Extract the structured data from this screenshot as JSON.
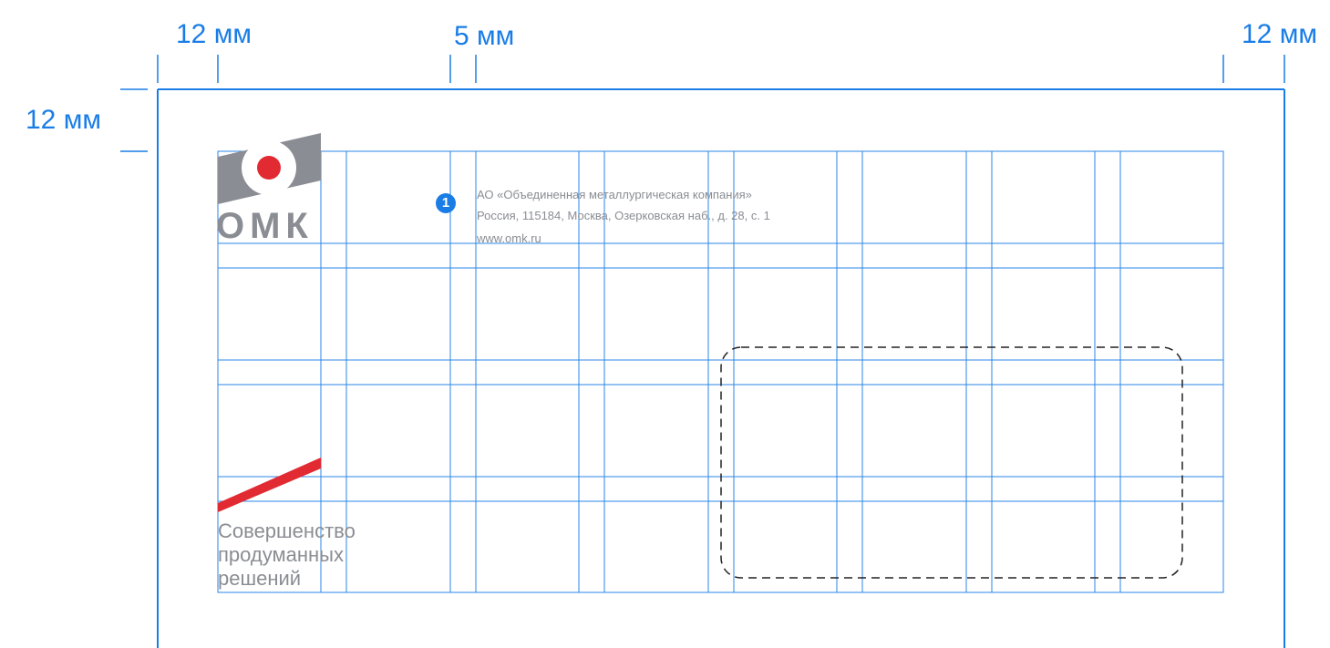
{
  "colors": {
    "guide": "#1a7de6",
    "grid": "#2b86e8",
    "logo_grey": "#8a8d93",
    "logo_red": "#e12a32",
    "window_dash": "#222222"
  },
  "dimensions": {
    "left_margin": "12 мм",
    "gutter": "5 мм",
    "right_margin": "12 мм",
    "top_margin": "12 мм"
  },
  "logo": {
    "wordmark": "ОМК",
    "icon": "omk-logo-icon"
  },
  "address": {
    "marker": "1",
    "line1": "АО «Объединенная металлургическая компания»",
    "line2": "Россия, 115184, Москва, Озерковская наб., д. 28, с. 1",
    "line3": "www.omk.ru"
  },
  "slogan": {
    "line1": "Совершенство",
    "line2": "продуманных",
    "line3": "решений"
  }
}
